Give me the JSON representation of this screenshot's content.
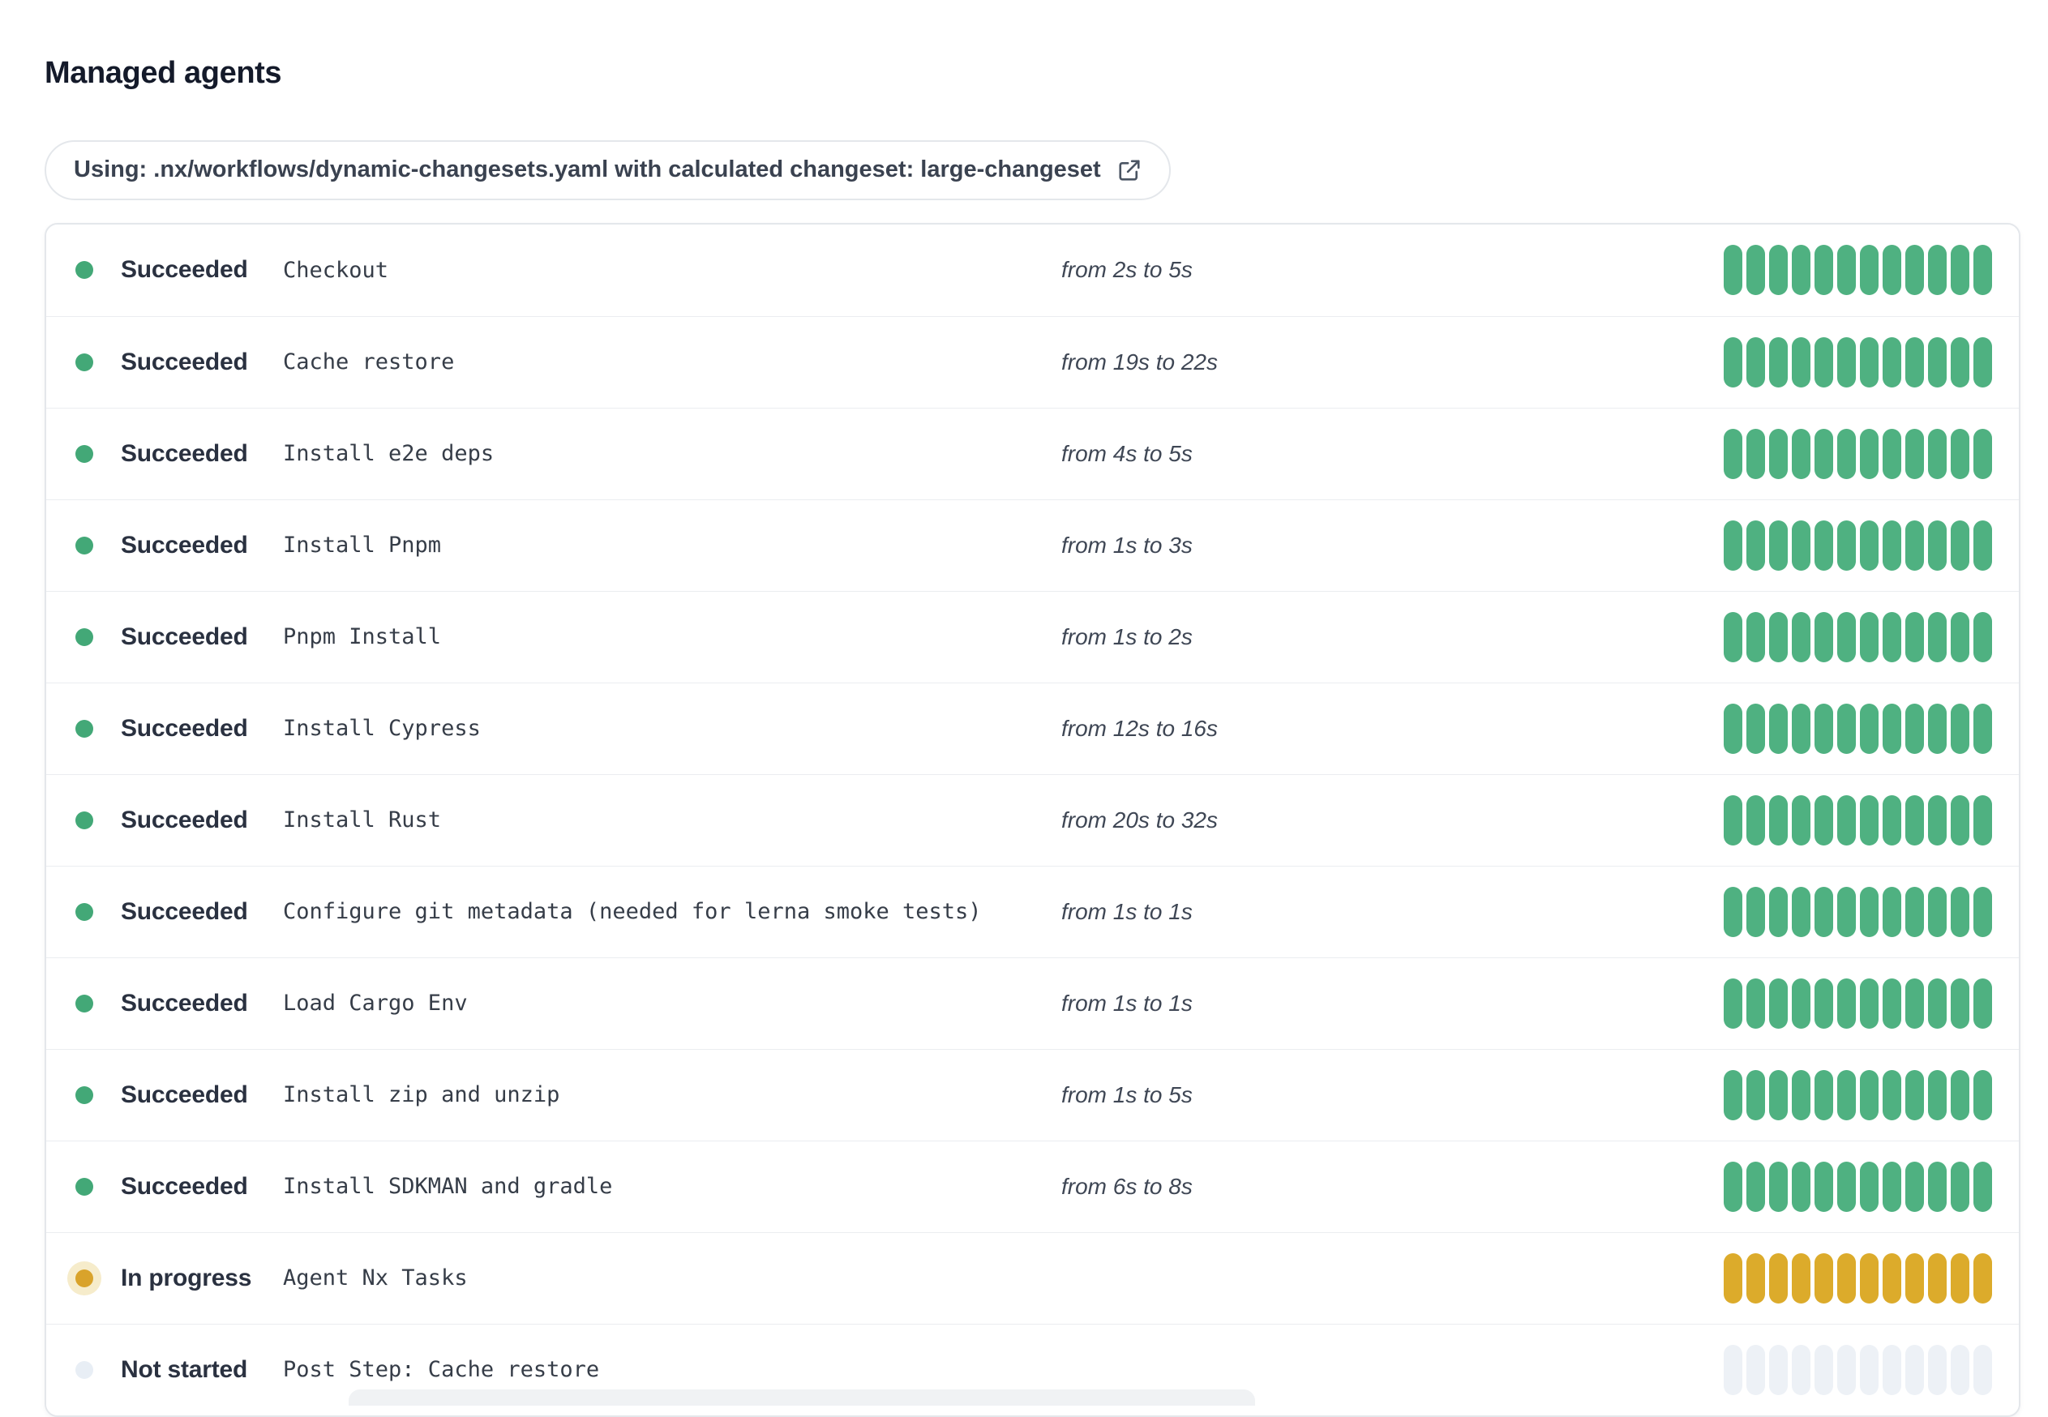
{
  "page": {
    "title": "Managed agents"
  },
  "usage_banner": {
    "text": "Using: .nx/workflows/dynamic-changesets.yaml with calculated changeset: large-changeset",
    "icon": "external-link-icon"
  },
  "colors": {
    "succeeded_bar": "#4fb181",
    "succeeded_dot": "#43a877",
    "in_progress_bar": "#dcab2b",
    "in_progress_dot": "#d9a32b",
    "in_progress_halo": "#f6eccb",
    "not_started_bar": "#edf1f6",
    "not_started_dot": "#e8eef5",
    "card_border": "#e4e7eb",
    "row_separator": "#ebedf0"
  },
  "segments_per_row": 12,
  "rows": [
    {
      "status_key": "succeeded",
      "status_label": "Succeeded",
      "name": "Checkout",
      "duration_text": "from 2s to 5s"
    },
    {
      "status_key": "succeeded",
      "status_label": "Succeeded",
      "name": "Cache restore",
      "duration_text": "from 19s to 22s"
    },
    {
      "status_key": "succeeded",
      "status_label": "Succeeded",
      "name": "Install e2e deps",
      "duration_text": "from 4s to 5s"
    },
    {
      "status_key": "succeeded",
      "status_label": "Succeeded",
      "name": "Install Pnpm",
      "duration_text": "from 1s to 3s"
    },
    {
      "status_key": "succeeded",
      "status_label": "Succeeded",
      "name": "Pnpm Install",
      "duration_text": "from 1s to 2s"
    },
    {
      "status_key": "succeeded",
      "status_label": "Succeeded",
      "name": "Install Cypress",
      "duration_text": "from 12s to 16s"
    },
    {
      "status_key": "succeeded",
      "status_label": "Succeeded",
      "name": "Install Rust",
      "duration_text": "from 20s to 32s"
    },
    {
      "status_key": "succeeded",
      "status_label": "Succeeded",
      "name": "Configure git metadata (needed for lerna smoke tests)",
      "duration_text": "from 1s to 1s"
    },
    {
      "status_key": "succeeded",
      "status_label": "Succeeded",
      "name": "Load Cargo Env",
      "duration_text": "from 1s to 1s"
    },
    {
      "status_key": "succeeded",
      "status_label": "Succeeded",
      "name": "Install zip and unzip",
      "duration_text": "from 1s to 5s"
    },
    {
      "status_key": "succeeded",
      "status_label": "Succeeded",
      "name": "Install SDKMAN and gradle",
      "duration_text": "from 6s to 8s"
    },
    {
      "status_key": "in_progress",
      "status_label": "In progress",
      "name": "Agent Nx Tasks",
      "duration_text": ""
    },
    {
      "status_key": "not_started",
      "status_label": "Not started",
      "name": "Post Step: Cache restore",
      "duration_text": ""
    }
  ]
}
